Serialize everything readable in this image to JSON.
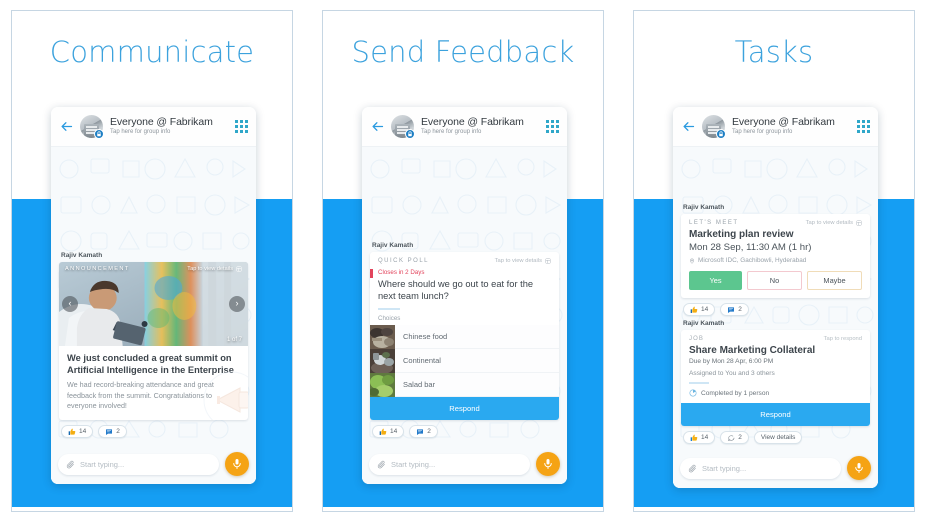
{
  "colors": {
    "band_blue": "#159ef3",
    "title_blue": "#3ca2dd",
    "accent_blue": "#2aa9f0",
    "mic_orange": "#f5a314",
    "yes_green": "#5cc68f",
    "alert_red": "#e2445c"
  },
  "panels": [
    {
      "title": "Communicate",
      "header": {
        "back_icon": "back-arrow-icon",
        "avatar_icon": "group-avatar",
        "title": "Everyone @ Fabrikam",
        "subtitle": "Tap here for group info",
        "grid_icon": "apps-grid-icon"
      },
      "sender": "Rajiv Kamath",
      "announcement": {
        "label": "ANNOUNCEMENT",
        "tap_to_view": "Tap to view details",
        "prev_icon": "chevron-left-icon",
        "next_icon": "chevron-right-icon",
        "counter": "1 of 7",
        "headline": "We just concluded a great summit on Artificial Intelligence in the Enterprise",
        "body": "We had record-breaking attendance and great feedback from the summit. Congratulations to everyone involved!"
      },
      "reactions": {
        "like_icon": "thumbs-up-icon",
        "like_count": "14",
        "comment_icon": "comment-icon",
        "comment_count": "2"
      },
      "composer": {
        "attach_icon": "paperclip-icon",
        "placeholder": "Start typing...",
        "mic_icon": "microphone-icon"
      }
    },
    {
      "title": "Send Feedback",
      "header": {
        "back_icon": "back-arrow-icon",
        "avatar_icon": "group-avatar",
        "title": "Everyone @ Fabrikam",
        "subtitle": "Tap here for group info",
        "grid_icon": "apps-grid-icon"
      },
      "sender": "Rajiv Kamath",
      "poll": {
        "label": "QUICK POLL",
        "tap_to_view": "Tap to view details",
        "closes": "Closes in 2 Days",
        "question": "Where should we go out to eat for the next team lunch?",
        "choices_label": "Choices",
        "choices": [
          {
            "label": "Chinese food",
            "thumb": "chinese-food-thumbnail"
          },
          {
            "label": "Continental",
            "thumb": "continental-food-thumbnail"
          },
          {
            "label": "Salad bar",
            "thumb": "salad-bar-thumbnail"
          }
        ],
        "respond_label": "Respond"
      },
      "reactions": {
        "like_icon": "thumbs-up-icon",
        "like_count": "14",
        "comment_icon": "comment-icon",
        "comment_count": "2"
      },
      "composer": {
        "attach_icon": "paperclip-icon",
        "placeholder": "Start typing...",
        "mic_icon": "microphone-icon"
      }
    },
    {
      "title": "Tasks",
      "header": {
        "back_icon": "back-arrow-icon",
        "avatar_icon": "group-avatar",
        "title": "Everyone @ Fabrikam",
        "subtitle": "Tap here for group info",
        "grid_icon": "apps-grid-icon"
      },
      "sender_1": "Rajiv Kamath",
      "meeting": {
        "label": "LET'S MEET",
        "tap_to_view": "Tap to view details",
        "title": "Marketing plan review",
        "time": "Mon 28 Sep, 11:30 AM (1 hr)",
        "location_icon": "location-pin-icon",
        "location": "Microsoft IDC, Gachibowli, Hyderabad",
        "rsvp": [
          "Yes",
          "No",
          "Maybe"
        ]
      },
      "reactions_1": {
        "like_icon": "thumbs-up-icon",
        "like_count": "14",
        "comment_icon": "comment-icon",
        "comment_count": "2"
      },
      "sender_2": "Rajiv Kamath",
      "job": {
        "label": "JOB",
        "tap_to_respond": "Tap to respond",
        "title": "Share Marketing Collateral",
        "due": "Due by Mon 28 Apr, 6:00 PM",
        "assigned": "Assigned to You and 3 others",
        "progress_icon": "pie-progress-icon",
        "completed": "Completed by 1 person",
        "respond_label": "Respond"
      },
      "reactions_2": {
        "like_icon": "thumbs-up-icon",
        "like_count": "14",
        "comment_icon": "comment-outline-icon",
        "comment_count": "2",
        "view_details": "View details"
      },
      "composer": {
        "attach_icon": "paperclip-icon",
        "placeholder": "Start typing...",
        "mic_icon": "microphone-icon"
      }
    }
  ]
}
